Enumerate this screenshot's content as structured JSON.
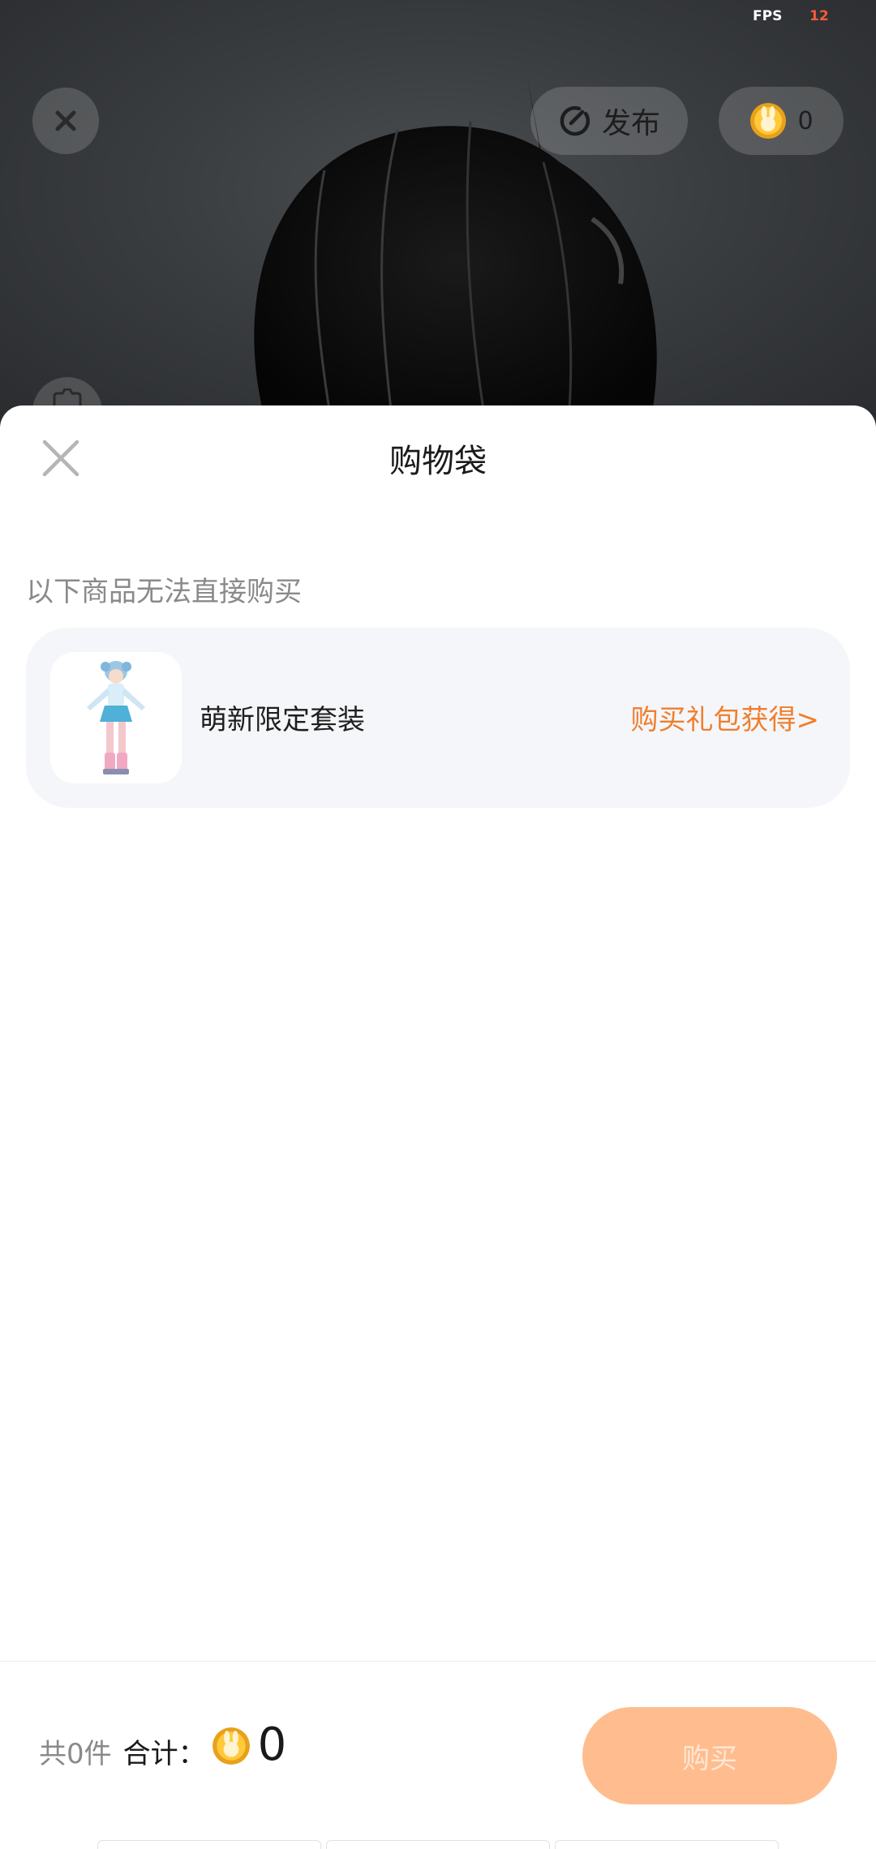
{
  "status": {
    "fps_label": "FPS",
    "fps_value": "12"
  },
  "viewport": {
    "publish_label": "发布",
    "coin_balance": "0"
  },
  "sheet": {
    "title": "购物袋",
    "notice": "以下商品无法直接购买",
    "items": [
      {
        "name": "萌新限定套装",
        "action": "购买礼包获得>"
      }
    ]
  },
  "footer": {
    "count_text": "共0件",
    "total_label": "合计：",
    "total_value": "0",
    "buy_label": "购买"
  },
  "colors": {
    "accent": "#ef7f2e",
    "buy_button": "#ffbd8f",
    "card_bg": "#f5f6f9"
  }
}
